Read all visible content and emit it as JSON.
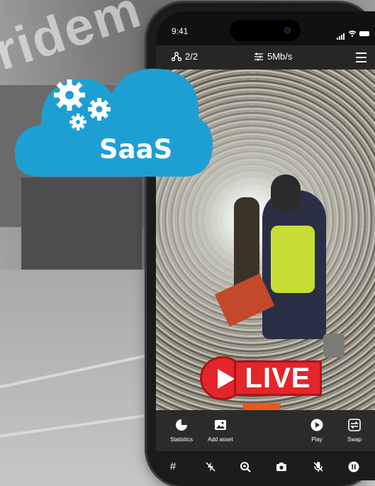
{
  "background": {
    "watermark_text": "ridem"
  },
  "badge": {
    "label": "SaaS",
    "cloud_color": "#1e9fd3",
    "icon": "gears-icon"
  },
  "statusbar": {
    "time": "9:41"
  },
  "topbar": {
    "peers_icon": "network-nodes-icon",
    "peers_count": "2/2",
    "bitrate_icon": "sliders-icon",
    "bitrate": "5Mb/s",
    "menu_icon": "hamburger-menu-icon"
  },
  "overlay": {
    "live_label": "LIVE",
    "live_color": "#e2262b"
  },
  "toolbar": {
    "statistics_label": "Statistics",
    "add_asset_label": "Add asset",
    "play_label": "Play",
    "swap_label": "Swap"
  },
  "controls": {
    "grid_icon": "grid-icon",
    "flash_off_icon": "flash-off-icon",
    "zoom_icon": "zoom-in-icon",
    "camera_icon": "camera-icon",
    "mic_off_icon": "mic-off-icon",
    "pause_icon": "pause-icon"
  }
}
